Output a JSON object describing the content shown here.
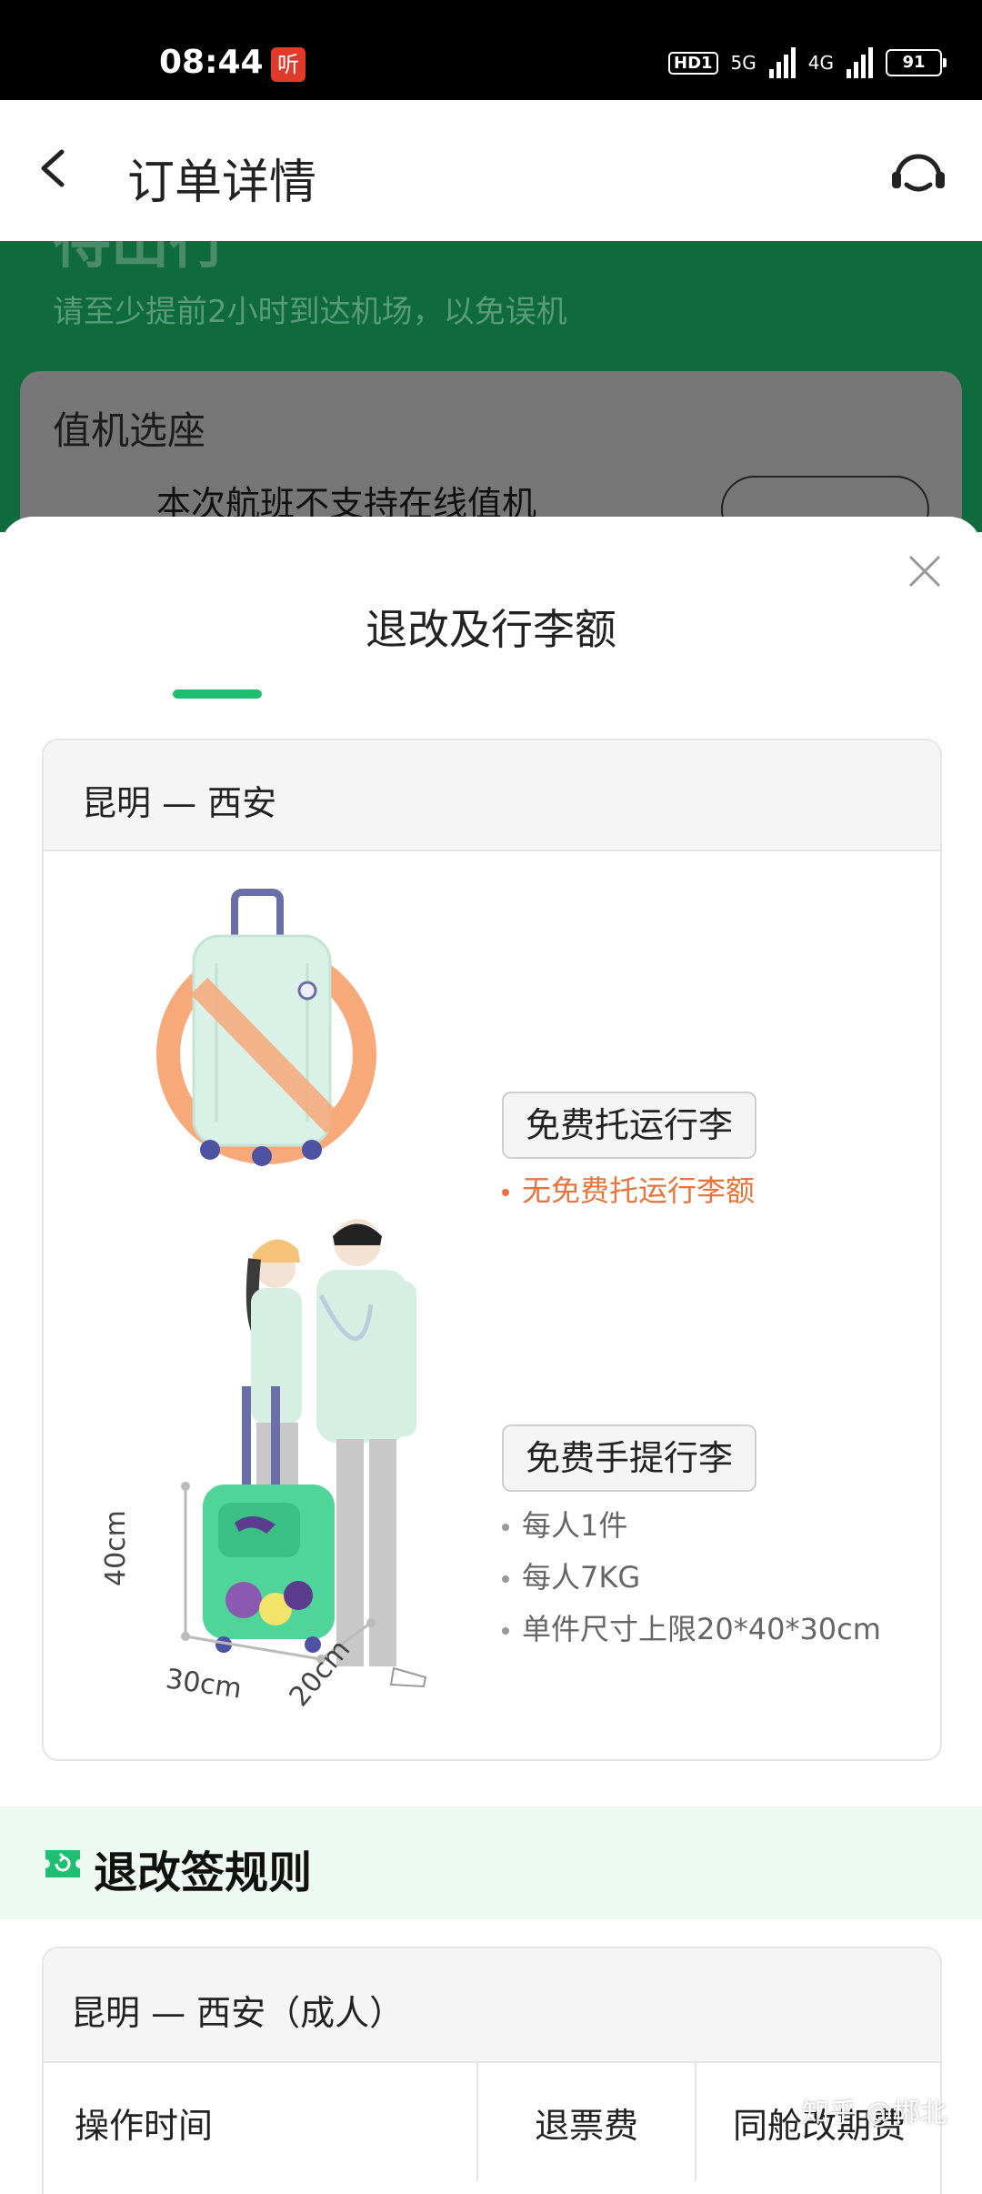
{
  "status_bar": {
    "time": "08:44",
    "app_badge": "听",
    "hd": "HD1",
    "net1": "5G",
    "net2": "4G",
    "battery": "91"
  },
  "header": {
    "title": "订单详情"
  },
  "background_page": {
    "status": "待出行",
    "hint": "请至少提前2小时到达机场，以免误机",
    "card_title": "值机选座",
    "card_text": "本次航班不支持在线值机"
  },
  "sheet": {
    "title": "退改及行李额",
    "baggage_card": {
      "route": "昆明 — 西安",
      "checked": {
        "label": "免费托运行李",
        "note": "无免费托运行李额"
      },
      "carry_on": {
        "label": "免费手提行李",
        "notes": [
          "每人1件",
          "每人7KG",
          "单件尺寸上限20*40*30cm"
        ]
      },
      "dims": {
        "height": "40cm",
        "width": "30cm",
        "depth": "20cm"
      }
    },
    "rules": {
      "title": "退改签规则",
      "route": "昆明 — 西安（成人）",
      "columns": [
        "操作时间",
        "退票费",
        "同舱改期费"
      ]
    }
  },
  "watermark": "知乎 @郴北",
  "colors": {
    "accent_green": "#1fbf72",
    "warn_orange": "#e8743b",
    "header_green": "#0f6a3c"
  }
}
